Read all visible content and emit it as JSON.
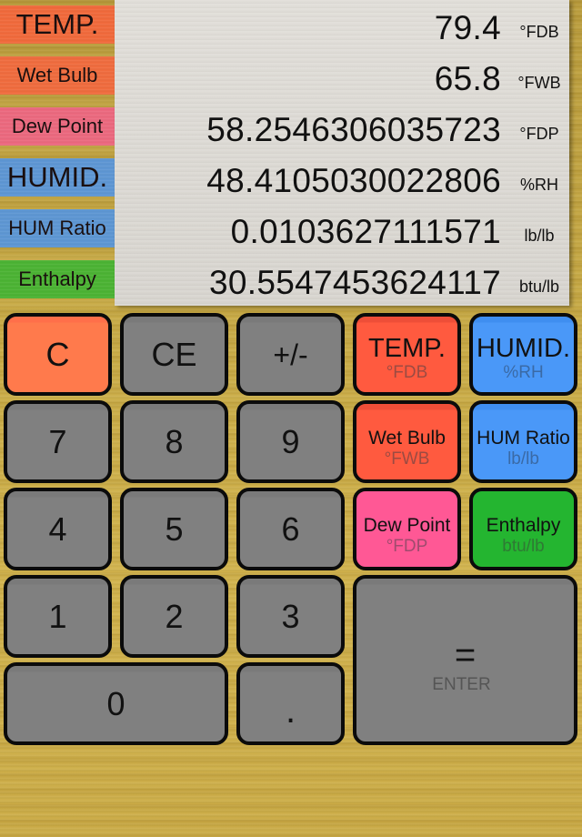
{
  "side_labels": [
    {
      "id": "temp",
      "label": "TEMP.",
      "color": "#f36b3c"
    },
    {
      "id": "wet-bulb",
      "label": "Wet Bulb",
      "color": "#f26d3f"
    },
    {
      "id": "dew-point",
      "label": "Dew Point",
      "color": "#ee6a80"
    },
    {
      "id": "humid",
      "label": "HUMID.",
      "color": "#5f98d6"
    },
    {
      "id": "hum-ratio",
      "label": "HUM Ratio",
      "color": "#5e98d5"
    },
    {
      "id": "enthalpy",
      "label": "Enthalpy",
      "color": "#4cb534"
    }
  ],
  "display": [
    {
      "id": "temp",
      "value": "79.4",
      "unit": "°FDB"
    },
    {
      "id": "wet-bulb",
      "value": "65.8",
      "unit": "°FWB"
    },
    {
      "id": "dew-point",
      "value": "58.2546306035723",
      "unit": "°FDP"
    },
    {
      "id": "humid",
      "value": "48.4105030022806",
      "unit": "%RH"
    },
    {
      "id": "hum-ratio",
      "value": "0.0103627111571",
      "unit": "lb/lb"
    },
    {
      "id": "enthalpy",
      "value": "30.5547453624117",
      "unit": "btu/lb"
    }
  ],
  "keys": {
    "clear": "C",
    "clear_entry": "CE",
    "sign": "+/-",
    "d7": "7",
    "d8": "8",
    "d9": "9",
    "d4": "4",
    "d5": "5",
    "d6": "6",
    "d1": "1",
    "d2": "2",
    "d3": "3",
    "d0": "0",
    "decimal": ".",
    "equals": "=",
    "equals_sub": "ENTER",
    "temp": {
      "label": "TEMP.",
      "unit": "°FDB"
    },
    "humid": {
      "label": "HUMID.",
      "unit": "%RH"
    },
    "wet_bulb": {
      "label": "Wet Bulb",
      "unit": "°FWB"
    },
    "hum_ratio": {
      "label": "HUM Ratio",
      "unit": "lb/lb"
    },
    "dew_point": {
      "label": "Dew Point",
      "unit": "°FDP"
    },
    "enthalpy": {
      "label": "Enthalpy",
      "unit": "btu/lb"
    }
  },
  "colors": {
    "clear_key": "#ff7a4c",
    "temp_key": "#ff5a3f",
    "humid_key": "#4a98f8",
    "dew_point_key": "#ff5895",
    "enthalpy_key": "#24b530",
    "number_key": "#808080",
    "background": "#c6a843"
  }
}
